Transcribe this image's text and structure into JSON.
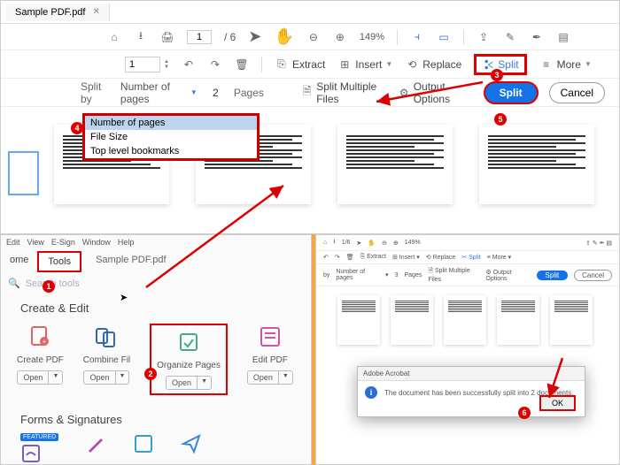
{
  "panel1": {
    "tab_title": "Sample PDF.pdf",
    "page_current": "1",
    "page_total": "/ 6",
    "zoom": "149%",
    "toolbar2": {
      "spin_value": "1",
      "extract": "Extract",
      "insert": "Insert",
      "replace": "Replace",
      "split": "Split",
      "more": "More"
    },
    "toolbar3": {
      "split_by": "Split by",
      "mode": "Number of pages",
      "num_pages": "2",
      "pages_label": "Pages",
      "split_multiple": "Split Multiple Files",
      "output_options": "Output Options",
      "split_btn": "Split",
      "cancel_btn": "Cancel"
    },
    "dropdown": {
      "opt1": "Number of pages",
      "opt2": "File Size",
      "opt3": "Top level bookmarks"
    }
  },
  "panel2": {
    "menu": {
      "edit": "Edit",
      "view": "View",
      "esign": "E-Sign",
      "window": "Window",
      "help": "Help"
    },
    "tabs": {
      "home": "ome",
      "tools": "Tools",
      "doc": "Sample PDF.pdf"
    },
    "search_placeholder": "Search tools",
    "sec1": "Create & Edit",
    "cards": {
      "create": "Create PDF",
      "combine": "Combine Fil",
      "organize": "Organize Pages",
      "editpdf": "Edit PDF",
      "open": "Open"
    },
    "sec2": "Forms & Signatures",
    "featured": "FEATURED"
  },
  "panel3": {
    "row2": {
      "extract": "Extract",
      "insert": "Insert",
      "replace": "Replace",
      "split": "Split",
      "more": "More"
    },
    "row3": {
      "by": "by",
      "mode": "Number of pages",
      "num": "3",
      "pages": "Pages",
      "multi": "Split Multiple Files",
      "opts": "Output Options",
      "split": "Split",
      "cancel": "Cancel"
    },
    "dlg": {
      "title": "Adobe Acrobat",
      "msg": "The document has been successfully split into 2 documents.",
      "ok": "OK"
    }
  },
  "badges": {
    "b1": "1",
    "b2": "2",
    "b3": "3",
    "b4": "4",
    "b5": "5",
    "b6": "6"
  }
}
